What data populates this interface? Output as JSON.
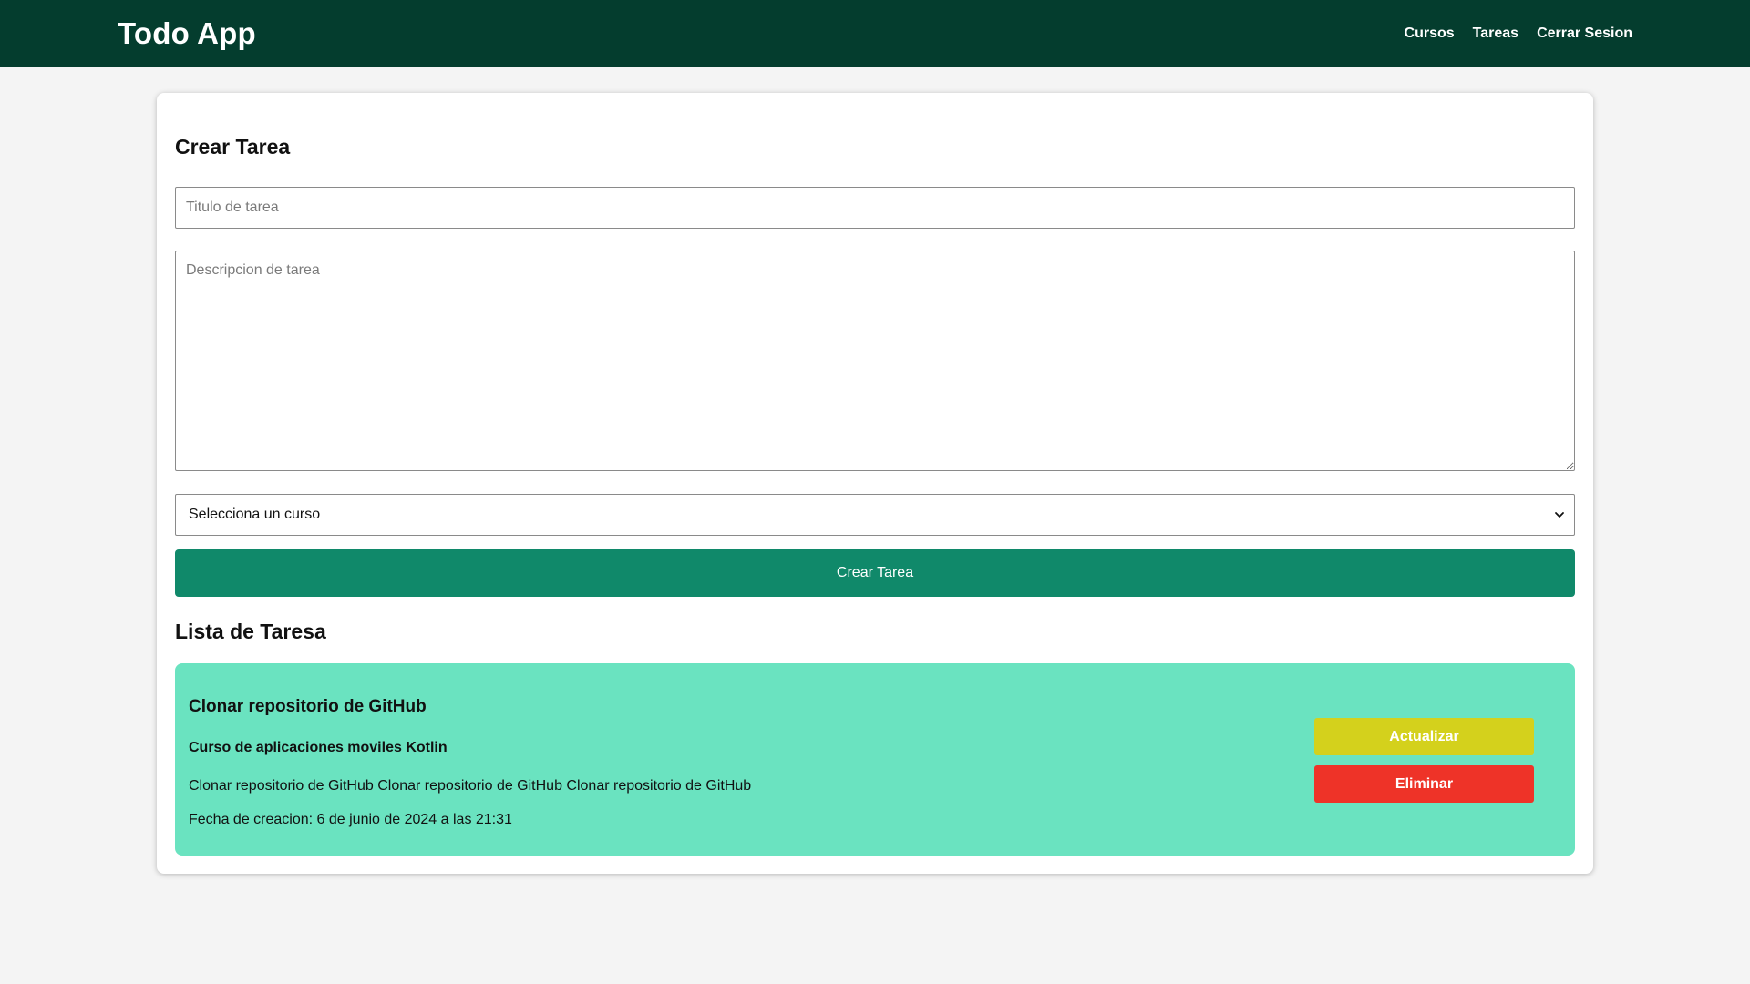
{
  "navbar": {
    "brand": "Todo App",
    "links": [
      "Cursos",
      "Tareas",
      "Cerrar Sesion"
    ]
  },
  "create_form": {
    "heading": "Crear Tarea",
    "title_placeholder": "Titulo de tarea",
    "description_placeholder": "Descripcion de tarea",
    "course_select_value": "Selecciona un curso",
    "submit_label": "Crear Tarea"
  },
  "task_list": {
    "heading": "Lista de Taresa",
    "tasks": [
      {
        "title": "Clonar repositorio de GitHub",
        "course": "Curso de aplicaciones moviles Kotlin",
        "description": "Clonar repositorio de GitHub Clonar repositorio de GitHub Clonar repositorio de GitHub",
        "created": "Fecha de creacion: 6 de junio de 2024 a las 21:31",
        "update_label": "Actualizar",
        "delete_label": "Eliminar"
      }
    ]
  },
  "colors": {
    "navbar": "#043d2e",
    "primary_button": "#10896a",
    "task_card": "#6ae3c0",
    "update_button": "#d4d11c",
    "delete_button": "#ee3328",
    "background": "#f4f4f4"
  },
  "icons": {
    "select_arrow": "chevron-down-icon"
  }
}
